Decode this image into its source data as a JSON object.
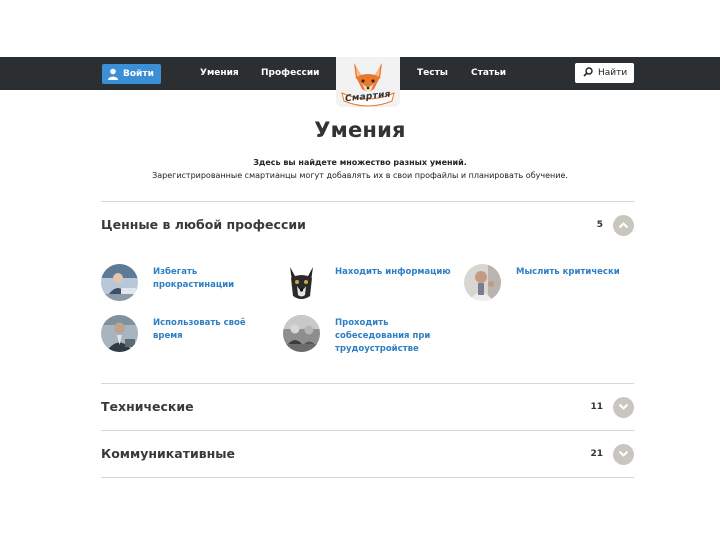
{
  "header": {
    "login_label": "Войти",
    "nav": [
      "Умения",
      "Профессии",
      "Тесты",
      "Статьи"
    ],
    "logo_text": "Смартия",
    "search_label": "Найти"
  },
  "main": {
    "title": "Умения",
    "intro_bold": "Здесь вы найдете множество разных умений.",
    "intro": "Зарегистрированные смартианцы могут добавлять их в свои профайлы и планировать обучение.",
    "sections": [
      {
        "title": "Ценные в любой профессии",
        "count": "5",
        "expanded": true,
        "skills": [
          {
            "label_lines": [
              "Избегать",
              "прокрастинации"
            ],
            "icon": "person-at-laptop-avatar"
          },
          {
            "label_lines": [
              "Находить информацию"
            ],
            "icon": "dog-avatar"
          },
          {
            "label_lines": [
              "Мыслить критически"
            ],
            "icon": "thinking-person-avatar"
          },
          {
            "label_lines": [
              "Использовать своё",
              "время"
            ],
            "icon": "business-man-avatar"
          },
          {
            "label_lines": [
              "Проходить",
              "собеседования при",
              "трудоустройстве"
            ],
            "icon": "interview-avatar"
          }
        ]
      },
      {
        "title": "Технические",
        "count": "11",
        "expanded": false
      },
      {
        "title": "Коммуникативные",
        "count": "21",
        "expanded": false
      }
    ]
  },
  "colors": {
    "topbar": "#2b2f31",
    "accent_blue": "#3b8fd6",
    "link_blue": "#2e7fc4",
    "toggle_gray": "#c9c6c0",
    "fox_orange": "#e8782a"
  }
}
